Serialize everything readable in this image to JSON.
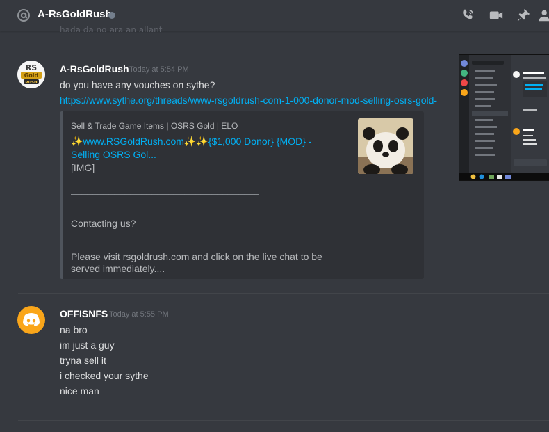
{
  "header": {
    "title": "A-RsGoldRush",
    "icons": [
      "at-icon",
      "call-icon",
      "video-icon",
      "pin-icon",
      "add-friend-icon"
    ]
  },
  "faded_text": "hada da ng ara an allant",
  "messages": [
    {
      "author": "A-RsGoldRush",
      "timestamp": "Today at 5:54 PM",
      "avatar_text": "RS Gold Rush",
      "text": "do you have any vouches on sythe?",
      "link": "https://www.sythe.org/threads/www-rsgoldrush-com-1-000-donor-mod-selling-osrs-gold-",
      "embed": {
        "provider": "Sell & Trade Game Items | OSRS Gold | ELO",
        "title": "✨www.RSGoldRush.com✨✨{$1,000 Donor} {MOD} - Selling OSRS Gol...",
        "img_tag": "[IMG]",
        "rule": "__________________________________________",
        "contact": "Contacting us?",
        "visit": "Please visit rsgoldrush.com and click on the live chat to be served immediately...."
      }
    },
    {
      "author": "OFFISNFS",
      "timestamp": "Today at 5:55 PM",
      "lines": [
        "na bro",
        "im just a guy",
        "tryna sell it",
        "i checked your sythe",
        "nice man"
      ]
    }
  ],
  "colors": {
    "background": "#36393f",
    "link": "#00b0f4",
    "embed_bg": "#2f3136",
    "discord_avatar": "#faa61a"
  }
}
